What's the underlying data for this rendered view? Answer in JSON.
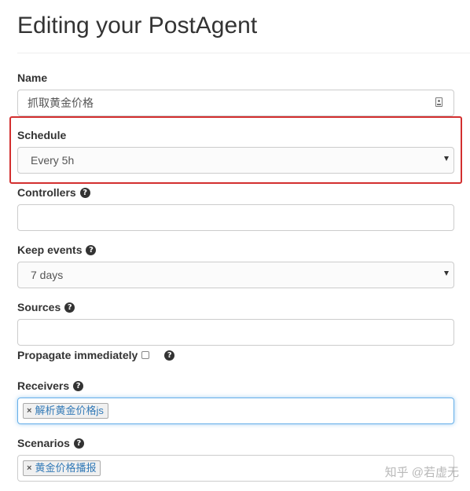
{
  "page": {
    "title": "Editing your PostAgent"
  },
  "form": {
    "name": {
      "label": "Name",
      "value": "抓取黄金价格"
    },
    "schedule": {
      "label": "Schedule",
      "value": "Every 5h"
    },
    "controllers": {
      "label": "Controllers",
      "value": ""
    },
    "keep_events": {
      "label": "Keep events",
      "value": "7 days"
    },
    "sources": {
      "label": "Sources",
      "value": ""
    },
    "propagate": {
      "label": "Propagate immediately",
      "checked": false
    },
    "receivers": {
      "label": "Receivers",
      "tokens": [
        "解析黄金价格js"
      ]
    },
    "scenarios": {
      "label": "Scenarios",
      "tokens": [
        "黄金价格播报"
      ]
    }
  },
  "icons": {
    "help": "?",
    "remove": "×",
    "name_field_icon": "contact-card-icon",
    "select_caret": "caret-down-icon"
  },
  "colors": {
    "highlight_border": "#d32f2f",
    "focus_border": "#66afe9",
    "token_text": "#337ab7"
  },
  "watermark": "知乎 @若虚无"
}
